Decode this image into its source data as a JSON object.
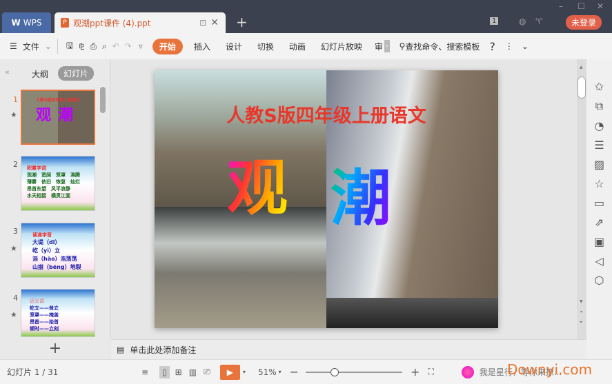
{
  "titlebar": {
    "app_tab": "WPS",
    "doc_tab": "观潮ppt课件 (4).ppt",
    "badge": "1",
    "login": "未登录"
  },
  "toolbar": {
    "file": "文件",
    "tabs": [
      "开始",
      "插入",
      "设计",
      "切换",
      "动画",
      "幻灯片放映",
      "审"
    ],
    "search": "查找命令、搜索模板",
    "help": "?"
  },
  "panel": {
    "outline_tab": "大纲",
    "slides_tab": "幻灯片",
    "add": "+"
  },
  "thumbnails": [
    {
      "num": "1",
      "title": "人教S版四年级上册语文",
      "big": "观潮"
    },
    {
      "num": "2",
      "heading": "积累字词",
      "lines": [
        "观潮　宽阔　笼罩　沸腾",
        "薄雾　依旧　恢复　灿烂",
        "昂首东望　风平浪静",
        "水天相接　横贯江面"
      ]
    },
    {
      "num": "3",
      "heading": "读准字音",
      "lines": [
        "大堤（dī）",
        "屹（yì）立",
        "浩（hào）浩荡荡",
        "山崩（bēng）地裂"
      ]
    },
    {
      "num": "4",
      "heading": "近义词",
      "lines": [
        "屹立——耸立",
        "笼罩——掩盖",
        "昂首——抬首",
        "顿时——立刻"
      ]
    }
  ],
  "slide": {
    "title": "人教S版四年级上册语文",
    "char1": "观",
    "char2": "潮"
  },
  "notes": {
    "placeholder": "单击此处添加备注"
  },
  "status": {
    "slide_counter": "幻灯片 1 / 31",
    "zoom": "51%",
    "zoom_fraction": 0.3,
    "assistant": "我是星行，等你来撩...",
    "watermark": "Downyi.com"
  },
  "colors": {
    "accent": "#e8743b",
    "titlebar": "#3c4150",
    "login": "#e0604a"
  }
}
